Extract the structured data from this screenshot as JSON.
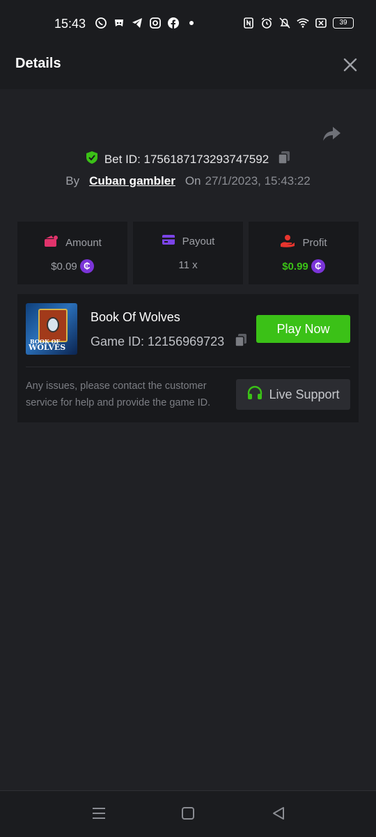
{
  "status_bar": {
    "time": "15:43",
    "battery": "39",
    "left_icons": [
      "whatsapp-icon",
      "discord-icon",
      "telegram-icon",
      "instagram-icon",
      "facebook-icon",
      "dot-icon"
    ],
    "right_icons": [
      "nfc-icon",
      "alarm-icon",
      "bell-muted-icon",
      "wifi-icon",
      "sim-off-icon",
      "battery-icon"
    ]
  },
  "header": {
    "title": "Details",
    "close_icon": "close-icon"
  },
  "bet": {
    "id_label": "Bet ID: 1756187173293747592",
    "by_label": "By",
    "user": "Cuban gambler",
    "on_label": "On",
    "datetime": "27/1/2023, 15:43:22"
  },
  "stats": {
    "amount": {
      "label": "Amount",
      "value": "$0.09"
    },
    "payout": {
      "label": "Payout",
      "value": "11 x"
    },
    "profit": {
      "label": "Profit",
      "value": "$0.99"
    },
    "coin_symbol": "₵"
  },
  "game": {
    "name": "Book Of Wolves",
    "id_label": "Game ID: 12156969723",
    "thumb_text_top": "BOOK OF",
    "thumb_text_bottom": "WOLVES",
    "play_label": "Play Now",
    "issue_text": "Any issues, please contact the customer service for help and provide the game ID.",
    "support_label": "Live Support"
  },
  "colors": {
    "accent_green": "#3bc117",
    "coin_purple": "#7b34d8",
    "amount_icon": "#e0336b",
    "payout_icon": "#7b44e8",
    "profit_icon": "#e8352e"
  }
}
